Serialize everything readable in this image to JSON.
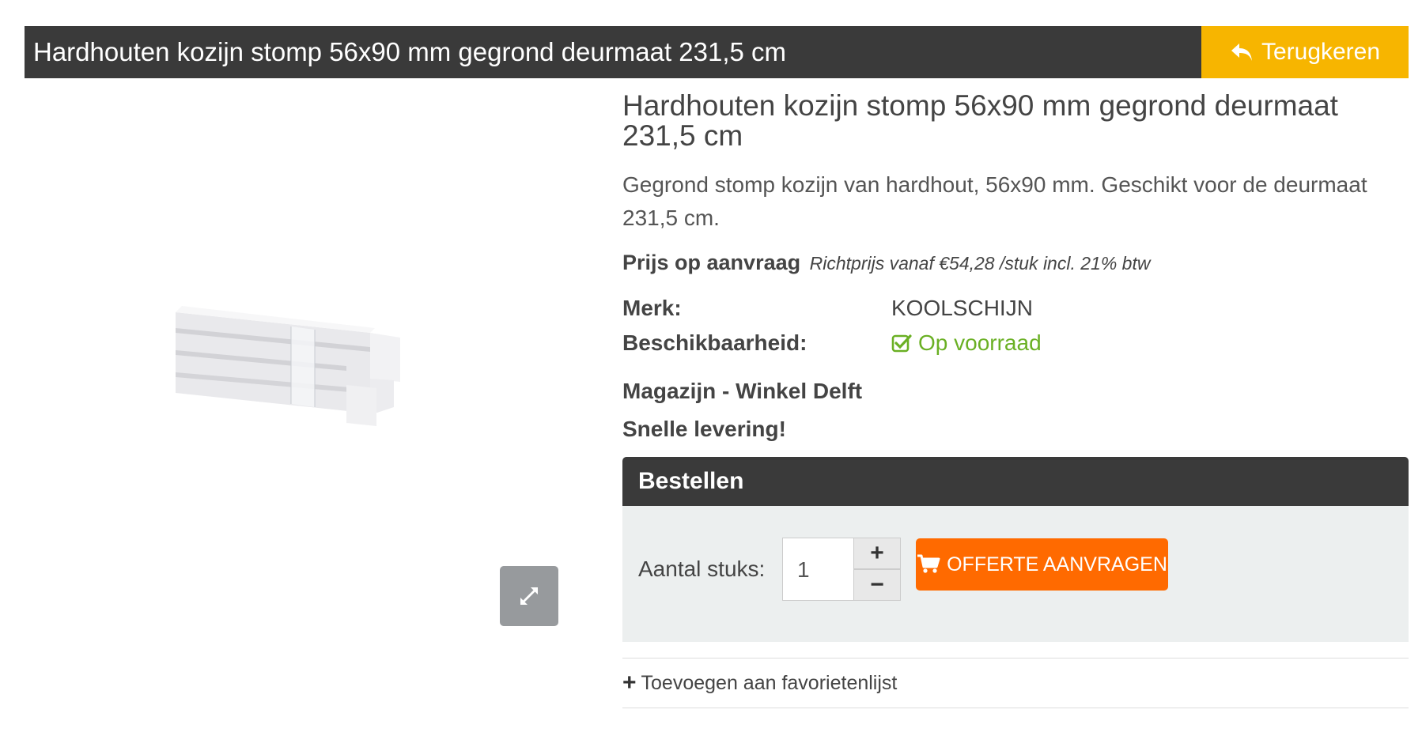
{
  "header": {
    "title": "Hardhouten kozijn stomp 56x90 mm gegrond deurmaat 231,5 cm",
    "back_label": "Terugkeren",
    "accent_color": "#f7b500"
  },
  "product": {
    "title": "Hardhouten kozijn stomp 56x90 mm gegrond deurmaat 231,5 cm",
    "description": "Gegrond stomp kozijn van hardhout, 56x90 mm. Geschikt voor de deurmaat 231,5 cm.",
    "price_main": "Prijs op aanvraag",
    "price_sub": "Richtprijs vanaf €54,28 /stuk incl. 21% btw",
    "image_icon": "wooden-frame-bundle-image",
    "zoom_icon": "expand-icon"
  },
  "specs": {
    "brand_label": "Merk:",
    "brand_value": "KOOLSCHIJN",
    "availability_label": "Beschikbaarheid:",
    "availability_value": "Op voorraad",
    "availability_color": "#6ab024"
  },
  "store_line": "Magazijn - Winkel Delft",
  "fast_delivery": "Snelle levering!",
  "order": {
    "header": "Bestellen",
    "qty_label": "Aantal stuks:",
    "qty_value": "1",
    "plus": "+",
    "minus": "−",
    "offer_label": "OFFERTE AANVRAGEN",
    "offer_color": "#ff6a00"
  },
  "favorites": {
    "label": "Toevoegen aan favorietenlijst",
    "icon": "+"
  }
}
